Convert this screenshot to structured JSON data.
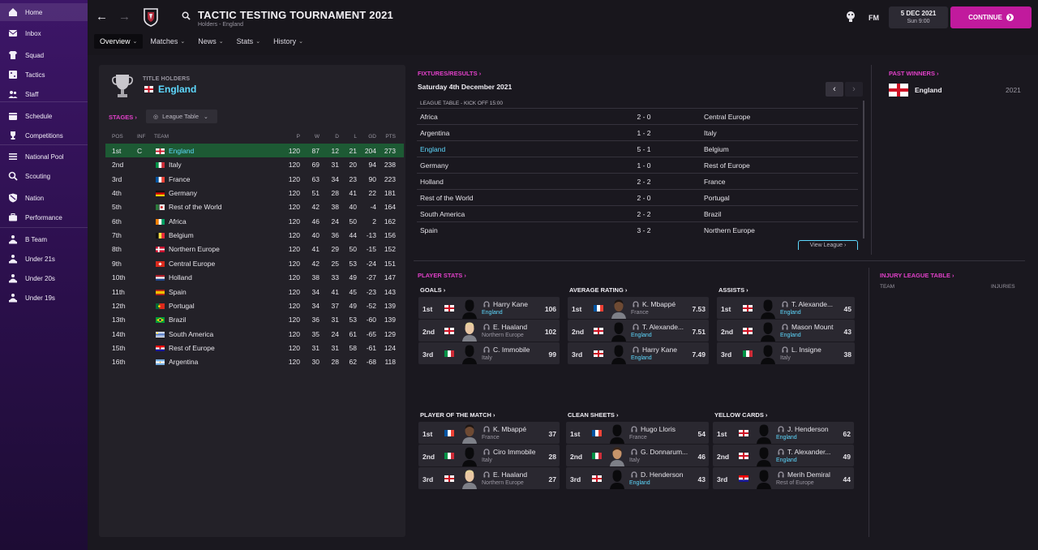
{
  "sidebar": {
    "items": [
      {
        "label": "Home",
        "icon": "home-icon"
      },
      {
        "label": "Inbox",
        "icon": "inbox-icon"
      },
      {
        "label": "Squad",
        "icon": "shirt-icon"
      },
      {
        "label": "Tactics",
        "icon": "tactics-board-icon"
      },
      {
        "label": "Staff",
        "icon": "staff-icon"
      },
      {
        "label": "Schedule",
        "icon": "calendar-icon"
      },
      {
        "label": "Competitions",
        "icon": "trophy-icon"
      },
      {
        "label": "National Pool",
        "icon": "list-icon"
      },
      {
        "label": "Scouting",
        "icon": "magnifier-icon"
      },
      {
        "label": "Nation",
        "icon": "shield-icon"
      },
      {
        "label": "Performance",
        "icon": "briefcase-icon"
      },
      {
        "label": "B Team",
        "icon": "team-icon"
      },
      {
        "label": "Under 21s",
        "icon": "team-icon"
      },
      {
        "label": "Under 20s",
        "icon": "team-icon"
      },
      {
        "label": "Under 19s",
        "icon": "team-icon"
      }
    ]
  },
  "header": {
    "title": "TACTIC TESTING TOURNAMENT 2021",
    "subtitle": "Holders - England",
    "fm_label": "FM",
    "date": "5 DEC 2021",
    "time": "Sun 9:00",
    "continue_label": "CONTINUE",
    "tabs": [
      "Overview",
      "Matches",
      "News",
      "Stats",
      "History"
    ]
  },
  "holders": {
    "label": "TITLE HOLDERS",
    "team": "England"
  },
  "stages": {
    "label": "STAGES",
    "dropdown": "League Table"
  },
  "league_table": {
    "headers": {
      "pos": "POS",
      "inf": "INF",
      "team": "TEAM",
      "p": "P",
      "w": "W",
      "d": "D",
      "l": "L",
      "gd": "GD",
      "pts": "PTS"
    },
    "rows": [
      {
        "pos": "1st",
        "inf": "C",
        "team": "England",
        "p": "120",
        "w": "87",
        "d": "12",
        "l": "21",
        "gd": "204",
        "pts": "273",
        "flag": "eng"
      },
      {
        "pos": "2nd",
        "inf": "",
        "team": "Italy",
        "p": "120",
        "w": "69",
        "d": "31",
        "l": "20",
        "gd": "94",
        "pts": "238",
        "flag": "ita"
      },
      {
        "pos": "3rd",
        "inf": "",
        "team": "France",
        "p": "120",
        "w": "63",
        "d": "34",
        "l": "23",
        "gd": "90",
        "pts": "223",
        "flag": "fra"
      },
      {
        "pos": "4th",
        "inf": "",
        "team": "Germany",
        "p": "120",
        "w": "51",
        "d": "28",
        "l": "41",
        "gd": "22",
        "pts": "181",
        "flag": "ger"
      },
      {
        "pos": "5th",
        "inf": "",
        "team": "Rest of the World",
        "p": "120",
        "w": "42",
        "d": "38",
        "l": "40",
        "gd": "-4",
        "pts": "164",
        "flag": "row"
      },
      {
        "pos": "6th",
        "inf": "",
        "team": "Africa",
        "p": "120",
        "w": "46",
        "d": "24",
        "l": "50",
        "gd": "2",
        "pts": "162",
        "flag": "afr"
      },
      {
        "pos": "7th",
        "inf": "",
        "team": "Belgium",
        "p": "120",
        "w": "40",
        "d": "36",
        "l": "44",
        "gd": "-13",
        "pts": "156",
        "flag": "bel"
      },
      {
        "pos": "8th",
        "inf": "",
        "team": "Northern Europe",
        "p": "120",
        "w": "41",
        "d": "29",
        "l": "50",
        "gd": "-15",
        "pts": "152",
        "flag": "neu"
      },
      {
        "pos": "9th",
        "inf": "",
        "team": "Central Europe",
        "p": "120",
        "w": "42",
        "d": "25",
        "l": "53",
        "gd": "-24",
        "pts": "151",
        "flag": "sui"
      },
      {
        "pos": "10th",
        "inf": "",
        "team": "Holland",
        "p": "120",
        "w": "38",
        "d": "33",
        "l": "49",
        "gd": "-27",
        "pts": "147",
        "flag": "ned"
      },
      {
        "pos": "11th",
        "inf": "",
        "team": "Spain",
        "p": "120",
        "w": "34",
        "d": "41",
        "l": "45",
        "gd": "-23",
        "pts": "143",
        "flag": "esp"
      },
      {
        "pos": "12th",
        "inf": "",
        "team": "Portugal",
        "p": "120",
        "w": "34",
        "d": "37",
        "l": "49",
        "gd": "-52",
        "pts": "139",
        "flag": "por"
      },
      {
        "pos": "13th",
        "inf": "",
        "team": "Brazil",
        "p": "120",
        "w": "36",
        "d": "31",
        "l": "53",
        "gd": "-60",
        "pts": "139",
        "flag": "bra"
      },
      {
        "pos": "14th",
        "inf": "",
        "team": "South America",
        "p": "120",
        "w": "35",
        "d": "24",
        "l": "61",
        "gd": "-65",
        "pts": "129",
        "flag": "uru"
      },
      {
        "pos": "15th",
        "inf": "",
        "team": "Rest of Europe",
        "p": "120",
        "w": "31",
        "d": "31",
        "l": "58",
        "gd": "-61",
        "pts": "124",
        "flag": "cro"
      },
      {
        "pos": "16th",
        "inf": "",
        "team": "Argentina",
        "p": "120",
        "w": "30",
        "d": "28",
        "l": "62",
        "gd": "-68",
        "pts": "118",
        "flag": "arg"
      }
    ]
  },
  "fixtures": {
    "label": "FIXTURES/RESULTS",
    "date": "Saturday 4th December 2021",
    "sub": "LEAGUE TABLE - KICK OFF 15:00",
    "view_label": "View League",
    "rows": [
      {
        "home": "Africa",
        "score": "2 - 0",
        "away": "Central Europe"
      },
      {
        "home": "Argentina",
        "score": "1 - 2",
        "away": "Italy"
      },
      {
        "home": "England",
        "score": "5 - 1",
        "away": "Belgium"
      },
      {
        "home": "Germany",
        "score": "1 - 0",
        "away": "Rest of Europe"
      },
      {
        "home": "Holland",
        "score": "2 - 2",
        "away": "France"
      },
      {
        "home": "Rest of the World",
        "score": "2 - 0",
        "away": "Portugal"
      },
      {
        "home": "South America",
        "score": "2 - 2",
        "away": "Brazil"
      },
      {
        "home": "Spain",
        "score": "3 - 2",
        "away": "Northern Europe"
      }
    ]
  },
  "past_winners": {
    "label": "PAST WINNERS",
    "team": "England",
    "year": "2021"
  },
  "player_stats": {
    "label": "PLAYER STATS",
    "groups": [
      {
        "title": "GOALS",
        "rows": [
          {
            "pos": "1st",
            "name": "Harry Kane",
            "club": "England",
            "val": "106",
            "nat": "eng",
            "blue": true,
            "face": "none"
          },
          {
            "pos": "2nd",
            "name": "E. Haaland",
            "club": "Northern Europe",
            "val": "102",
            "nat": "eng",
            "blue": false,
            "face": "blond"
          },
          {
            "pos": "3rd",
            "name": "C. Immobile",
            "club": "Italy",
            "val": "99",
            "nat": "ita",
            "blue": false,
            "face": "none"
          }
        ]
      },
      {
        "title": "AVERAGE RATING",
        "rows": [
          {
            "pos": "1st",
            "name": "K. Mbappé",
            "club": "France",
            "val": "7.53",
            "nat": "fra",
            "blue": false,
            "face": "dark"
          },
          {
            "pos": "2nd",
            "name": "T. Alexande...",
            "club": "England",
            "val": "7.51",
            "nat": "eng",
            "blue": true,
            "face": "none"
          },
          {
            "pos": "3rd",
            "name": "Harry Kane",
            "club": "England",
            "val": "7.49",
            "nat": "eng",
            "blue": true,
            "face": "none"
          }
        ]
      },
      {
        "title": "ASSISTS",
        "rows": [
          {
            "pos": "1st",
            "name": "T. Alexande...",
            "club": "England",
            "val": "45",
            "nat": "eng",
            "blue": true,
            "face": "none"
          },
          {
            "pos": "2nd",
            "name": "Mason Mount",
            "club": "England",
            "val": "43",
            "nat": "eng",
            "blue": true,
            "face": "none"
          },
          {
            "pos": "3rd",
            "name": "L. Insigne",
            "club": "Italy",
            "val": "38",
            "nat": "ita",
            "blue": false,
            "face": "none"
          }
        ]
      },
      {
        "title": "PLAYER OF THE MATCH",
        "rows": [
          {
            "pos": "1st",
            "name": "K. Mbappé",
            "club": "France",
            "val": "37",
            "nat": "fra",
            "blue": false,
            "face": "dark"
          },
          {
            "pos": "2nd",
            "name": "Ciro Immobile",
            "club": "Italy",
            "val": "28",
            "nat": "ita",
            "blue": false,
            "face": "none"
          },
          {
            "pos": "3rd",
            "name": "E. Haaland",
            "club": "Northern Europe",
            "val": "27",
            "nat": "eng",
            "blue": false,
            "face": "blond"
          }
        ]
      },
      {
        "title": "CLEAN SHEETS",
        "rows": [
          {
            "pos": "1st",
            "name": "Hugo Lloris",
            "club": "France",
            "val": "54",
            "nat": "fra",
            "blue": false,
            "face": "none"
          },
          {
            "pos": "2nd",
            "name": "G. Donnarum...",
            "club": "Italy",
            "val": "46",
            "nat": "ita",
            "blue": false,
            "face": "brown"
          },
          {
            "pos": "3rd",
            "name": "D. Henderson",
            "club": "England",
            "val": "43",
            "nat": "eng",
            "blue": true,
            "face": "none"
          }
        ]
      },
      {
        "title": "YELLOW CARDS",
        "rows": [
          {
            "pos": "1st",
            "name": "J. Henderson",
            "club": "England",
            "val": "62",
            "nat": "eng",
            "blue": true,
            "face": "none"
          },
          {
            "pos": "2nd",
            "name": "T. Alexander...",
            "club": "England",
            "val": "49",
            "nat": "eng",
            "blue": true,
            "face": "none"
          },
          {
            "pos": "3rd",
            "name": "Merih Demiral",
            "club": "Rest of Europe",
            "val": "44",
            "nat": "cro",
            "blue": false,
            "face": "none"
          }
        ]
      }
    ]
  },
  "injury": {
    "label": "INJURY LEAGUE TABLE",
    "col1": "TEAM",
    "col2": "INJURIES"
  }
}
